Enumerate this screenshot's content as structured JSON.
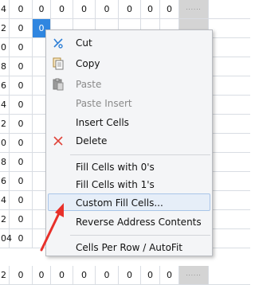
{
  "grid": {
    "rows": [
      {
        "addr": "4",
        "cells": [
          "0",
          "0",
          "0",
          "0",
          "0",
          "0",
          "0",
          "0"
        ],
        "tail": "......"
      },
      {
        "addr": "2",
        "cells": [
          "0",
          "0",
          "",
          "",
          "",
          "",
          "",
          ""
        ],
        "tail": ""
      },
      {
        "addr": "0",
        "cells": [
          "0",
          "",
          "",
          "",
          "",
          "",
          "",
          ""
        ],
        "tail": ""
      },
      {
        "addr": "8",
        "cells": [
          "0",
          "",
          "",
          "",
          "",
          "",
          "",
          ""
        ],
        "tail": ""
      },
      {
        "addr": "6",
        "cells": [
          "0",
          "",
          "",
          "",
          "",
          "",
          "",
          ""
        ],
        "tail": ""
      },
      {
        "addr": "4",
        "cells": [
          "0",
          "",
          "",
          "",
          "",
          "",
          "",
          ""
        ],
        "tail": ""
      },
      {
        "addr": "2",
        "cells": [
          "0",
          "",
          "",
          "",
          "",
          "",
          "",
          ""
        ],
        "tail": ""
      },
      {
        "addr": "0",
        "cells": [
          "0",
          "",
          "",
          "",
          "",
          "",
          "",
          ""
        ],
        "tail": ""
      },
      {
        "addr": "8",
        "cells": [
          "0",
          "",
          "",
          "",
          "",
          "",
          "",
          ""
        ],
        "tail": ""
      },
      {
        "addr": "6",
        "cells": [
          "0",
          "",
          "",
          "",
          "",
          "",
          "",
          ""
        ],
        "tail": ""
      },
      {
        "addr": "4",
        "cells": [
          "0",
          "",
          "",
          "",
          "",
          "",
          "",
          ""
        ],
        "tail": ""
      },
      {
        "addr": "2",
        "cells": [
          "0",
          "",
          "",
          "",
          "",
          "",
          "",
          ""
        ],
        "tail": ""
      },
      {
        "addr": "04",
        "cells": [
          "0",
          "",
          "",
          "",
          "",
          "",
          "",
          ""
        ],
        "tail": ""
      },
      {
        "addr": "2",
        "cells": [
          "0",
          "0",
          "0",
          "0",
          "0",
          "0",
          "0",
          "0"
        ],
        "tail": "......"
      }
    ],
    "selected_cell_value": "0",
    "colors": {
      "selected": "#2f86e0",
      "tail_column": "#d4d4d4"
    }
  },
  "context_menu": {
    "items": [
      {
        "label": "Cut",
        "icon": "scissors-icon",
        "disabled": false
      },
      {
        "label": "Copy",
        "icon": "copy-icon",
        "disabled": false
      },
      {
        "label": "Paste",
        "icon": "paste-icon",
        "disabled": true
      },
      {
        "label": "Paste Insert",
        "icon": "",
        "disabled": true
      },
      {
        "label": "Insert Cells",
        "icon": "",
        "disabled": false
      },
      {
        "label": "Delete",
        "icon": "delete-x-icon",
        "disabled": false
      },
      {
        "label": "Fill Cells with 0's",
        "icon": "",
        "disabled": false
      },
      {
        "label": "Fill Cells with 1's",
        "icon": "",
        "disabled": false
      },
      {
        "label": "Custom Fill Cells...",
        "icon": "",
        "disabled": false,
        "highlighted": true
      },
      {
        "label": "Reverse Address Contents",
        "icon": "",
        "disabled": false
      },
      {
        "label": "Cells Per Row / AutoFit",
        "icon": "",
        "disabled": false
      }
    ]
  },
  "annotation": {
    "color": "#e8302a",
    "icon": "red-pointer-arrow"
  }
}
